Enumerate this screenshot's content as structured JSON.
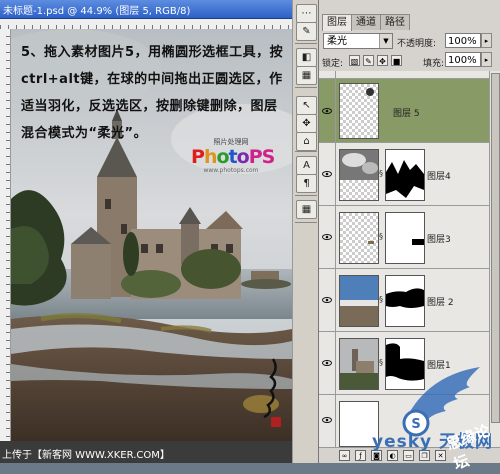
{
  "document": {
    "title": "未标题-1.psd @ 44.9% (图层 5, RGB/8)",
    "tutorial_text": "5、拖入素材图片5，用椭圆形选框工具，按ctrl+alt键，在球的中间拖出正圆选区，作适当羽化，反选选区，按删除键删除，图层混合模式为“柔光”。",
    "brand_subtitle": "照片处理网",
    "brand_logo": "PhotoPS",
    "brand_url": "www.photops.com",
    "status_text": "上传于【新客网 WWW.XKER.COM】"
  },
  "tools": {
    "icons": [
      "path-icon",
      "arrow-icon",
      "text-paragraph-icon",
      "brush-icon",
      "stamp-icon",
      "text-icon",
      "paragraph-icon",
      "grid-icon"
    ],
    "labels": [
      "⋯",
      "↖",
      "¶",
      "✎",
      "✥",
      "A",
      "¶",
      "▦"
    ]
  },
  "layers_panel": {
    "tabs": [
      "图层",
      "通道",
      "路径"
    ],
    "blend_mode": "柔光",
    "opacity_label": "不透明度:",
    "opacity_value": "100%",
    "lock_label": "锁定:",
    "fill_label": "填充:",
    "fill_value": "100%",
    "layers": [
      {
        "name": "",
        "visible": true,
        "selected": false
      },
      {
        "name": "图层 5",
        "visible": true,
        "selected": true
      },
      {
        "name": "图层4",
        "visible": true,
        "selected": false
      },
      {
        "name": "图层3",
        "visible": true,
        "selected": false
      },
      {
        "name": "图层 2",
        "visible": true,
        "selected": false
      },
      {
        "name": "图层1",
        "visible": true,
        "selected": false
      },
      {
        "name": "",
        "visible": true,
        "selected": false
      }
    ]
  },
  "watermark": {
    "brand": "yesky 天极网",
    "brand2": "思缘论坛"
  },
  "colors": {
    "selected_layer": "#889a66",
    "panel_bg": "#d6d3ce",
    "status_bg": "#3b3b3b"
  }
}
